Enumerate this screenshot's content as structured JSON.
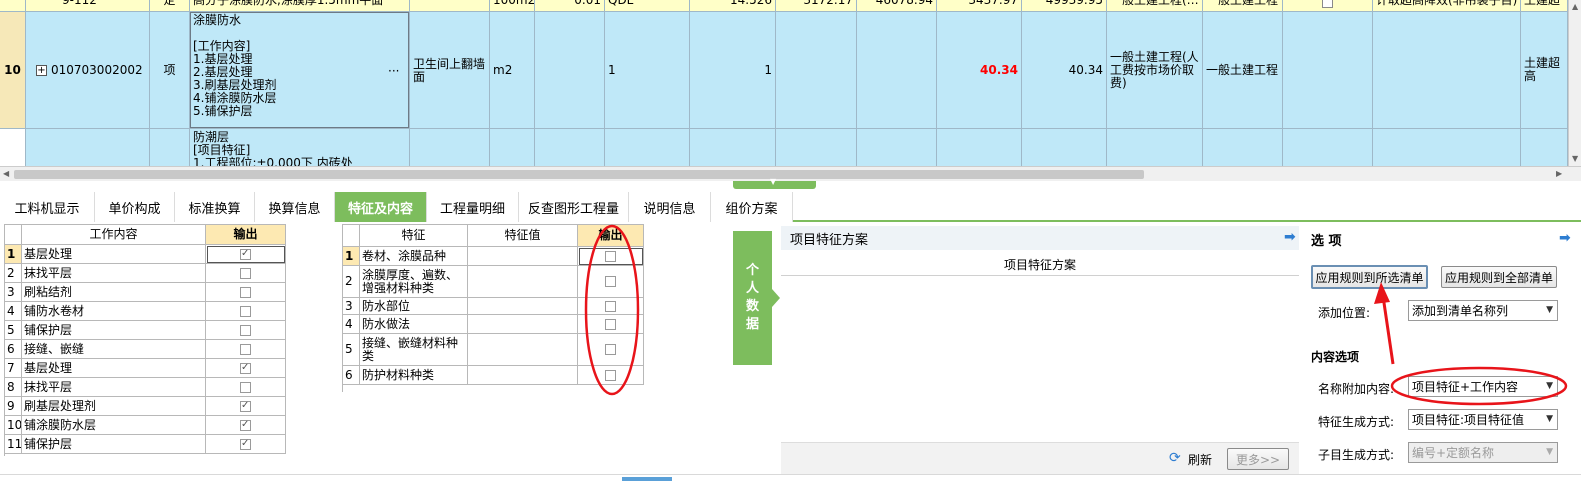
{
  "grid": {
    "row_prev": {
      "code": "9-112",
      "type": "定",
      "name": "高分子涂膜防水,涂膜厚1.5mm平面",
      "unit": "100m2",
      "expr": "0.01",
      "qty_code": "QDL",
      "c1": "14.526",
      "c2": "3172.17",
      "c3": "46078.94",
      "c4": "3437.97",
      "c5": "49939.95",
      "fee_type": "一般土建工程(…",
      "specialty": "一般土建工程",
      "remark": "计取超高降效(非吊装子目)",
      "last": "土建超"
    },
    "row_main": {
      "row_no": "10",
      "expand": "+",
      "code": "010703002002",
      "type": "项",
      "name_lines": [
        "涂膜防水",
        "",
        "[工作内容]",
        "1.基层处理",
        "2.基层处理",
        "3.刷基层处理剂",
        "4.铺涂膜防水层",
        "5.铺保护层"
      ],
      "ellipsis": "···",
      "feature": "卫生间上翻墙面",
      "unit": "m2",
      "expr": "1",
      "qty": "1",
      "price_red": "40.34",
      "total": "40.34",
      "fee_type": "一般土建工程(人工费按市场价取费)",
      "specialty": "一般土建工程",
      "last": "土建超高"
    },
    "row_next": {
      "name_lines": [
        "防潮层",
        "[项目特征]",
        "1.工程部位:±0.000下  内砖处"
      ]
    }
  },
  "tabs": [
    {
      "label": "工料机显示"
    },
    {
      "label": "单价构成"
    },
    {
      "label": "标准换算"
    },
    {
      "label": "换算信息"
    },
    {
      "label": "特征及内容"
    },
    {
      "label": "工程量明细"
    },
    {
      "label": "反查图形工程量"
    },
    {
      "label": "说明信息"
    },
    {
      "label": "组价方案"
    }
  ],
  "work_table": {
    "col_content": "工作内容",
    "col_output": "输出",
    "rows": [
      {
        "no": "1",
        "label": "基层处理",
        "checked": true
      },
      {
        "no": "2",
        "label": "抹找平层",
        "checked": false
      },
      {
        "no": "3",
        "label": "刷粘结剂",
        "checked": false
      },
      {
        "no": "4",
        "label": "铺防水卷材",
        "checked": false
      },
      {
        "no": "5",
        "label": "铺保护层",
        "checked": false
      },
      {
        "no": "6",
        "label": "接缝、嵌缝",
        "checked": false
      },
      {
        "no": "7",
        "label": "基层处理",
        "checked": true
      },
      {
        "no": "8",
        "label": "抹找平层",
        "checked": false
      },
      {
        "no": "9",
        "label": "刷基层处理剂",
        "checked": true
      },
      {
        "no": "10",
        "label": "铺涂膜防水层",
        "checked": true
      },
      {
        "no": "11",
        "label": "铺保护层",
        "checked": true
      }
    ]
  },
  "feature_table": {
    "col_feature": "特征",
    "col_value": "特征值",
    "col_output": "输出",
    "rows": [
      {
        "no": "1",
        "label": "卷材、涂膜品种"
      },
      {
        "no": "2",
        "label": "涂膜厚度、遍数、增强材料种类"
      },
      {
        "no": "3",
        "label": "防水部位"
      },
      {
        "no": "4",
        "label": "防水做法"
      },
      {
        "no": "5",
        "label": "接缝、嵌缝材料种类"
      },
      {
        "no": "6",
        "label": "防护材料种类"
      }
    ]
  },
  "personal_data": {
    "chars": [
      "个",
      "人",
      "数",
      "据"
    ]
  },
  "scheme_panel": {
    "title": "项目特征方案",
    "column": "项目特征方案",
    "refresh": "刷新",
    "more": "更多>>"
  },
  "options_panel": {
    "title": "选 项",
    "btn_apply_selected": "应用规则到所选清单",
    "btn_apply_all": "应用规则到全部清单",
    "add_position_label": "添加位置:",
    "add_position_value": "添加到清单名称列",
    "content_options": "内容选项",
    "name_append_label": "名称附加内容:",
    "name_append_value": "项目特征+工作内容",
    "feature_mode_label": "特征生成方式:",
    "feature_mode_value": "项目特征:项目特征值",
    "child_mode_label": "子目生成方式:",
    "child_mode_value": "编号+定额名称"
  },
  "colors": {
    "accent_green": "#7dbd5d",
    "annotation_red": "#e8141a",
    "row_blue": "#bfe8f8",
    "row_yellow": "#ffffc8"
  }
}
